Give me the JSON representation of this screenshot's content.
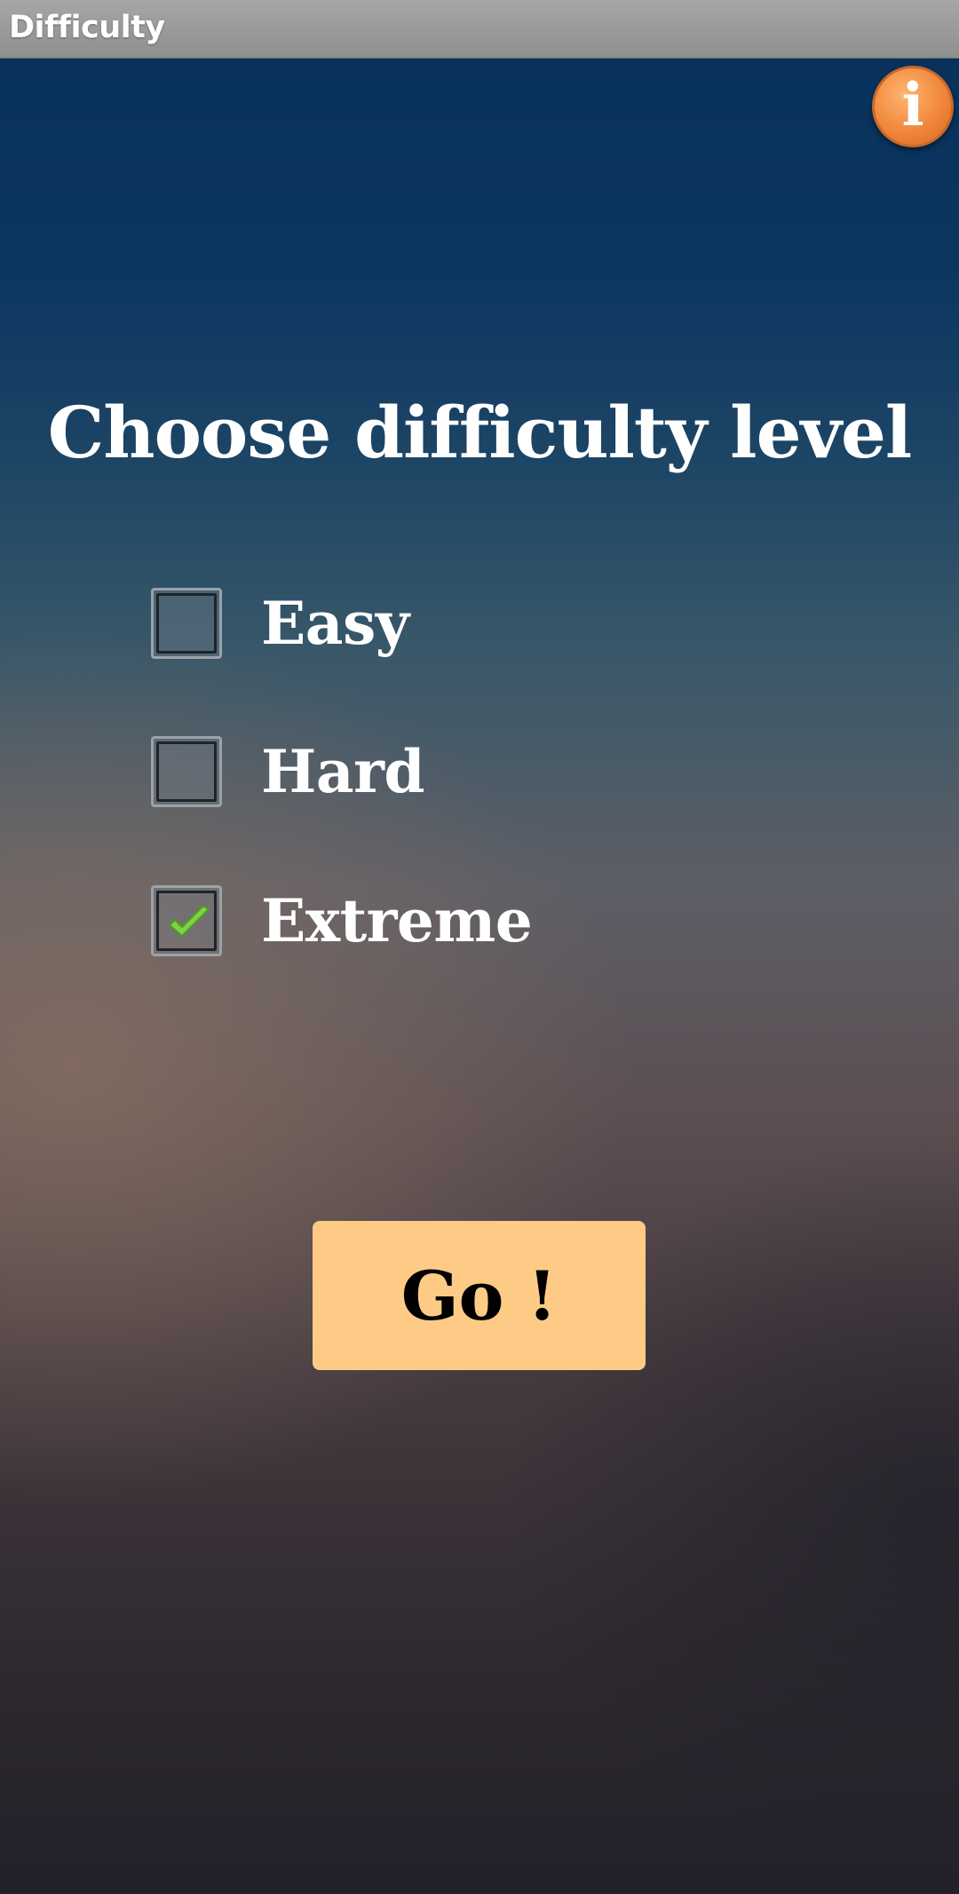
{
  "app": {
    "title": "Difficulty"
  },
  "info_button": {
    "glyph": "i",
    "icon": "info-icon",
    "color": "#f0873a"
  },
  "main": {
    "heading": "Choose difficulty level",
    "options": [
      {
        "label": "Easy",
        "checked": false
      },
      {
        "label": "Hard",
        "checked": false
      },
      {
        "label": "Extreme",
        "checked": true
      }
    ],
    "go_label": "Go !"
  },
  "colors": {
    "button_bg": "#fdcb86",
    "check_mark": "#7ed14a"
  }
}
